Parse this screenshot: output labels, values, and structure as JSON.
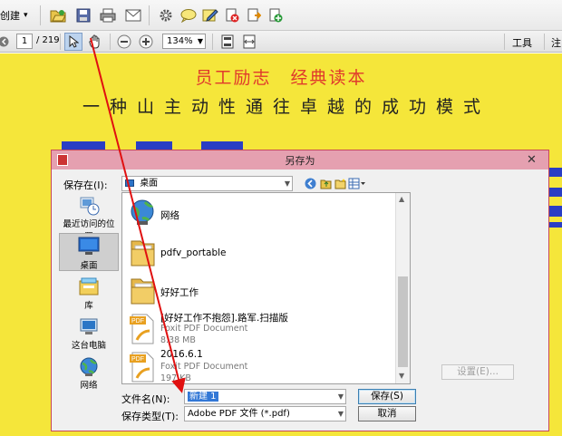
{
  "toolbar": {
    "create_label": "创建",
    "create_arrow": "▾",
    "page_current": "1",
    "page_total": "/ 219",
    "zoom": "134%",
    "tools_label": "工具",
    "comment_label": "注"
  },
  "document": {
    "heading": "员工励志　经典读本",
    "subtitle": "一种山主动性通往卓越的成功模式"
  },
  "dialog": {
    "title": "另存为",
    "close_glyph": "✕",
    "save_in_label": "保存在(I):",
    "save_in_value": "桌面",
    "places": [
      {
        "label": "最近访问的位置"
      },
      {
        "label": "桌面"
      },
      {
        "label": "库"
      },
      {
        "label": "这台电脑"
      },
      {
        "label": "网络"
      }
    ],
    "files": [
      {
        "name": "网络",
        "sub1": "",
        "sub2": ""
      },
      {
        "name": "pdfv_portable",
        "sub1": "",
        "sub2": ""
      },
      {
        "name": "好好工作",
        "sub1": "",
        "sub2": ""
      },
      {
        "name": "[好好工作不抱怨].路军.扫描版",
        "sub1": "Foxit PDF Document",
        "sub2": "8.38 MB"
      },
      {
        "name": "2016.6.1",
        "sub1": "Foxit PDF Document",
        "sub2": "197 KB"
      }
    ],
    "filename_label": "文件名(N):",
    "filename_value": "新建 1",
    "filetype_label": "保存类型(T):",
    "filetype_value": "Adobe PDF 文件 (*.pdf)",
    "save_button": "保存(S)",
    "cancel_button": "取消",
    "settings_button": "设置(E)..."
  },
  "colors": {
    "doc_background": "#f5e63a",
    "heading_red": "#e03a2c",
    "dialog_border": "#c7485a",
    "annotation_arrow": "#e01010"
  }
}
